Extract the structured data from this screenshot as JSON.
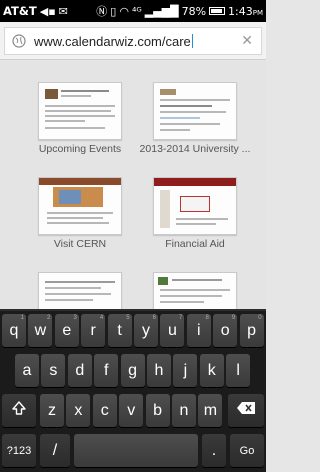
{
  "status_bar": {
    "carrier": "AT&T",
    "battery": "78%",
    "time": "1:43",
    "ampm": "PM"
  },
  "url_bar": {
    "url": "www.calendarwiz.com/care"
  },
  "bookmarks": [
    {
      "label": "Upcoming Events"
    },
    {
      "label": "2013-2014 University ..."
    },
    {
      "label": "Visit CERN"
    },
    {
      "label": "Financial Aid"
    }
  ],
  "keyboard": {
    "row1": [
      "q",
      "w",
      "e",
      "r",
      "t",
      "y",
      "u",
      "i",
      "o",
      "p"
    ],
    "row1_hints": [
      "1",
      "2",
      "3",
      "4",
      "5",
      "6",
      "7",
      "8",
      "9",
      "0"
    ],
    "row2": [
      "a",
      "s",
      "d",
      "f",
      "g",
      "h",
      "j",
      "k",
      "l"
    ],
    "row3": [
      "z",
      "x",
      "c",
      "v",
      "b",
      "n",
      "m"
    ],
    "symbols_label": "?123",
    "slash": "/",
    "period": ".",
    "go_label": "Go"
  },
  "colors": {
    "caret": "#2a8bd6",
    "keyboard_bg": "#1b1b1b",
    "key_bg": "#454545"
  }
}
